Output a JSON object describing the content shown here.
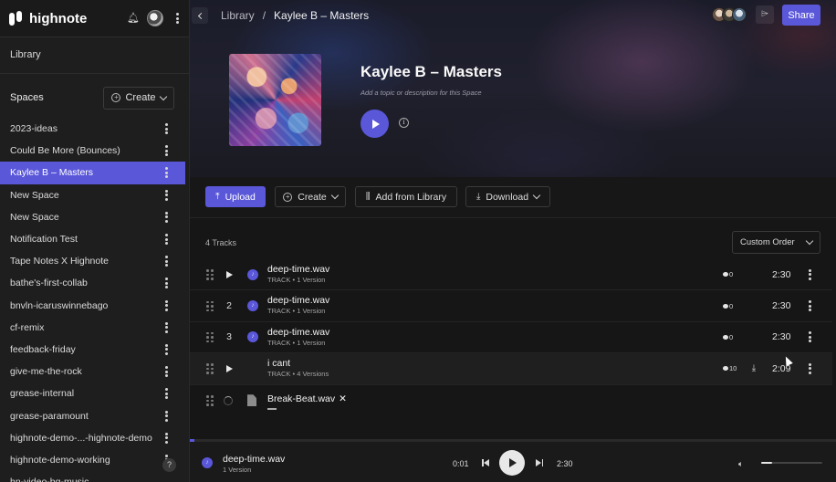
{
  "app": {
    "name": "highnote"
  },
  "sidebar": {
    "library_label": "Library",
    "spaces_title": "Spaces",
    "create_label": "Create",
    "help_glyph": "?",
    "items": [
      {
        "label": "2023-ideas"
      },
      {
        "label": "Could Be More (Bounces)"
      },
      {
        "label": "Kaylee B – Masters",
        "active": true
      },
      {
        "label": "New Space"
      },
      {
        "label": "New Space"
      },
      {
        "label": "Notification Test"
      },
      {
        "label": "Tape Notes X Highnote"
      },
      {
        "label": "bathe's-first-collab"
      },
      {
        "label": "bnvln-icaruswinnebago"
      },
      {
        "label": "cf-remix"
      },
      {
        "label": "feedback-friday"
      },
      {
        "label": "give-me-the-rock"
      },
      {
        "label": "grease-internal"
      },
      {
        "label": "grease-paramount"
      },
      {
        "label": "highnote-demo-...-highnote-demo"
      },
      {
        "label": "highnote-demo-working"
      },
      {
        "label": "hn-video-bg-music"
      }
    ]
  },
  "header": {
    "breadcrumb_root": "Library",
    "breadcrumb_sep": "/",
    "breadcrumb_current": "Kaylee B – Masters",
    "share_label": "Share"
  },
  "space": {
    "title": "Kaylee B – Masters",
    "description_placeholder": "Add a topic or description for this Space"
  },
  "toolbar": {
    "upload_label": "Upload",
    "create_label": "Create",
    "add_library_label": "Add from Library",
    "download_label": "Download"
  },
  "tracklist": {
    "count_label": "4 Tracks",
    "order_label": "Custom Order",
    "tracks": [
      {
        "index": "",
        "name": "deep-time.wav",
        "meta": "TRACK • 1 Version",
        "comments": "0",
        "duration": "2:30"
      },
      {
        "index": "2",
        "name": "deep-time.wav",
        "meta": "TRACK • 1 Version",
        "comments": "0",
        "duration": "2:30"
      },
      {
        "index": "3",
        "name": "deep-time.wav",
        "meta": "TRACK • 1 Version",
        "comments": "0",
        "duration": "2:30"
      },
      {
        "index": "",
        "name": "i cant",
        "meta": "TRACK • 4 Versions",
        "comments": "10",
        "duration": "2:09"
      }
    ],
    "uploading": {
      "name": "Break-Beat.wav",
      "remove_glyph": "✕"
    }
  },
  "player": {
    "track_name": "deep-time.wav",
    "track_meta": "1 Version",
    "elapsed": "0:01",
    "total": "2:30",
    "progress": 0.007,
    "volume": 0.18
  },
  "colors": {
    "accent": "#5a57d9",
    "sidebar_bg": "#1e1e1e",
    "main_bg": "#161616"
  }
}
